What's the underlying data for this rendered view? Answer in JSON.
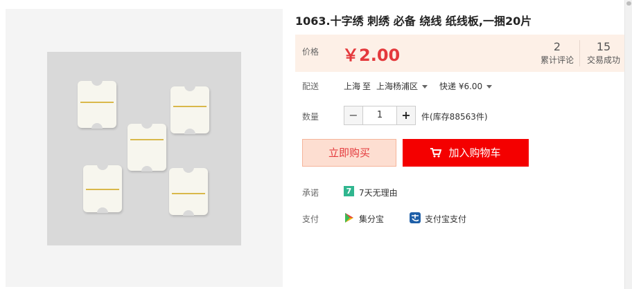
{
  "product": {
    "title": "1063.十字绣 刺绣 必备 绕线 纸线板,一捆20片"
  },
  "price": {
    "label": "价格",
    "value": "￥2.00",
    "color": "#e4393c",
    "reviews_count": "2",
    "reviews_label": "累计评论",
    "sales_count": "15",
    "sales_label": "交易成功"
  },
  "shipping": {
    "label": "配送",
    "from": "上海",
    "to_word": "至",
    "destination": "上海杨浦区",
    "method": "快递 ¥6.00"
  },
  "quantity": {
    "label": "数量",
    "minus": "−",
    "value": "1",
    "plus": "+",
    "stock": "件(库存88563件)"
  },
  "actions": {
    "buy_now": "立即购买",
    "add_to_cart": "加入购物车",
    "cart_color": "#f40000"
  },
  "promise": {
    "label": "承诺",
    "badge": "7",
    "text": "7天无理由"
  },
  "payment": {
    "label": "支付",
    "methods": [
      {
        "icon": "jifenbao-icon",
        "label": "集分宝"
      },
      {
        "icon": "alipay-icon",
        "label": "支付宝支付"
      }
    ]
  }
}
